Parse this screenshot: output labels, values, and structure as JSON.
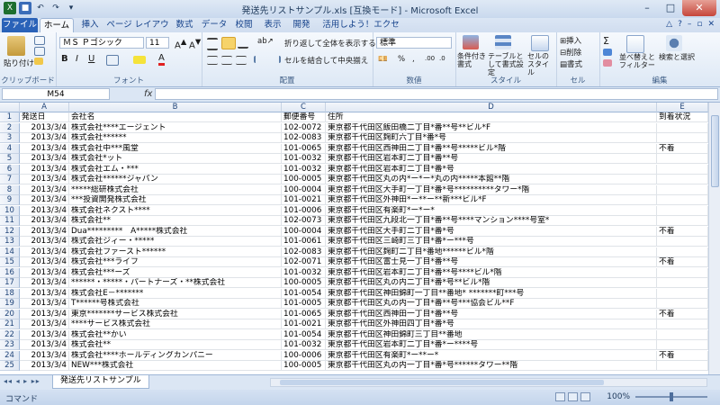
{
  "title": "発送先リストサンプル.xls [互換モード] - Microsoft Excel",
  "tabs": {
    "file": "ファイル",
    "home": "ホーム",
    "insert": "挿入",
    "layout": "ページ レイアウト",
    "formulas": "数式",
    "data": "データ",
    "review": "校閲",
    "view": "表示",
    "developer": "開発",
    "trial": "活用しよう！エクセル"
  },
  "ribbon": {
    "clipboard": {
      "label": "クリップボード",
      "paste": "貼り付け"
    },
    "font": {
      "label": "フォント",
      "name": "ＭＳ Ｐゴシック",
      "size": "11"
    },
    "alignment": {
      "label": "配置",
      "wrap": "折り返して全体を表示する",
      "merge": "セルを結合して中央揃え"
    },
    "number": {
      "label": "数値",
      "format": "標準"
    },
    "styles": {
      "label": "スタイル",
      "cond": "条件付き書式",
      "table": "テーブルとして書式設定",
      "cell": "セルのスタイル"
    },
    "cells": {
      "label": "セル",
      "insert": "挿入",
      "delete": "削除",
      "format": "書式"
    },
    "editing": {
      "label": "編集",
      "sort": "並べ替えとフィルター",
      "find": "検索と選択"
    }
  },
  "namebox": "M54",
  "fx": "fx",
  "columns": [
    "A",
    "B",
    "C",
    "D",
    "E"
  ],
  "rows": [
    [
      "1",
      "発送日",
      "会社名",
      "郵便番号",
      "住所",
      "到着状況"
    ],
    [
      "2",
      "2013/3/4",
      "株式会社****エージェント",
      "102-0072",
      "東京都千代田区飯田橋二丁目*番**号**ビル*F",
      ""
    ],
    [
      "3",
      "2013/3/4",
      "株式会社******",
      "102-0083",
      "東京都千代田区麹町六丁目*番*号",
      ""
    ],
    [
      "4",
      "2013/3/4",
      "株式会社中***風堂",
      "101-0065",
      "東京都千代田区西神田二丁目*番**号*****ビル*階",
      "不着"
    ],
    [
      "5",
      "2013/3/4",
      "株式会社*ット",
      "101-0032",
      "東京都千代田区岩本町二丁目*番**号",
      ""
    ],
    [
      "6",
      "2013/3/4",
      "株式会社エム・***",
      "101-0032",
      "東京都千代田区岩本町二丁目*番*号",
      ""
    ],
    [
      "7",
      "2013/3/4",
      "株式会社******ジャパン",
      "100-0005",
      "東京都千代田区丸の内*ー*ー*丸の内*****本館**階",
      ""
    ],
    [
      "8",
      "2013/3/4",
      "*****総研株式会社",
      "100-0004",
      "東京都千代田区大手町一丁目*番*号**********タワー*階",
      ""
    ],
    [
      "9",
      "2013/3/4",
      "***投資開発株式会社",
      "101-0021",
      "東京都千代田区外神田*ー**ー**新***ビル*F",
      ""
    ],
    [
      "10",
      "2013/3/4",
      "株式会社ネクスト****",
      "101-0006",
      "東京都千代田区有楽町*ー*ー*",
      ""
    ],
    [
      "11",
      "2013/3/4",
      "株式会社**",
      "102-0073",
      "東京都千代田区九段北一丁目*番**号****マンション****号室*",
      ""
    ],
    [
      "12",
      "2013/3/4",
      "Dua*********　A*****株式会社",
      "100-0004",
      "東京都千代田区大手町二丁目*番*号",
      "不着"
    ],
    [
      "13",
      "2013/3/4",
      "株式会社ジィー・*****",
      "101-0061",
      "東京都千代田区三崎町三丁目*番*ー***号",
      ""
    ],
    [
      "14",
      "2013/3/4",
      "株式会社ファースト******",
      "102-0083",
      "東京都千代田区麹町二丁目*番地******ビル*階",
      ""
    ],
    [
      "15",
      "2013/3/4",
      "株式会社***ライフ",
      "102-0071",
      "東京都千代田区富士見一丁目*番**号",
      "不着"
    ],
    [
      "16",
      "2013/3/4",
      "株式会社***ーズ",
      "101-0032",
      "東京都千代田区岩本町二丁目*番**号****ビル*階",
      ""
    ],
    [
      "17",
      "2013/3/4",
      "******・*****・パートナーズ・**株式会社",
      "100-0005",
      "東京都千代田区丸の内二丁目*番*号**ビル*階",
      ""
    ],
    [
      "18",
      "2013/3/4",
      "株式会社E－*******",
      "101-0054",
      "東京都千代田区神田錦町一丁目**番地* *******町***号",
      ""
    ],
    [
      "19",
      "2013/3/4",
      "T******号株式会社",
      "101-0005",
      "東京都千代田区丸の内一丁目*番**号***協会ビル**F",
      ""
    ],
    [
      "20",
      "2013/3/4",
      "東京*******サービス株式会社",
      "101-0065",
      "東京都千代田区西神田一丁目*番**号",
      "不着"
    ],
    [
      "21",
      "2013/3/4",
      "****サービス株式会社",
      "101-0021",
      "東京都千代田区外神田四丁目*番*号",
      ""
    ],
    [
      "22",
      "2013/3/4",
      "株式会社**かい",
      "101-0054",
      "東京都千代田区神田錦町三丁目**番地",
      ""
    ],
    [
      "23",
      "2013/3/4",
      "株式会社**",
      "101-0032",
      "東京都千代田区岩本町二丁目*番*ー****号",
      ""
    ],
    [
      "24",
      "2013/3/4",
      "株式会社****ホールディングカンパニー",
      "100-0006",
      "東京都千代田区有楽町*ー**ー*",
      "不着"
    ],
    [
      "25",
      "2013/3/4",
      "NEW***株式会社",
      "100-0005",
      "東京都千代田区丸の内一丁目*番*号******タワー**階",
      ""
    ]
  ],
  "sheet_tab": "発送先リストサンプル",
  "status": "コマンド",
  "zoom": "100%"
}
